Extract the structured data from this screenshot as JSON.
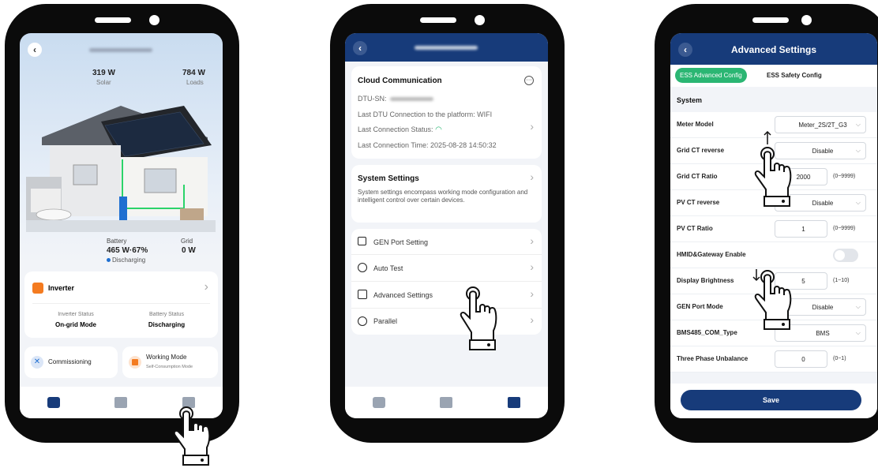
{
  "screen1": {
    "solar": {
      "value": "319 W",
      "label": "Solar"
    },
    "loads": {
      "value": "784 W",
      "label": "Loads"
    },
    "battery": {
      "label": "Battery",
      "value": "465 W·67%",
      "status": "Discharging"
    },
    "grid": {
      "label": "Grid",
      "value": "0 W"
    },
    "inverter": {
      "title": "Inverter",
      "inverter_status_label": "Inverter Status",
      "inverter_status": "On-grid Mode",
      "battery_status_label": "Battery Status",
      "battery_status": "Discharging"
    },
    "commissioning": "Commissioning",
    "working_mode": {
      "title": "Working Mode",
      "value": "Self-Consumption Mode"
    }
  },
  "screen2": {
    "cloud": {
      "title": "Cloud Communication",
      "dtu_sn": "DTU-SN:",
      "last_connection": "Last DTU Connection to the platform: WIFI",
      "last_status": "Last Connection Status:",
      "last_time": "Last Connection Time: 2025-08-28 14:50:32"
    },
    "system": {
      "title": "System Settings",
      "desc": "System settings encompass working mode configuration and intelligent control over certain devices."
    },
    "menu": [
      "GEN Port Setting",
      "Auto Test",
      "Advanced Settings",
      "Parallel"
    ]
  },
  "screen3": {
    "title": "Advanced Settings",
    "tabs": [
      "ESS Advanced Config",
      "ESS Safety Config"
    ],
    "section": "System",
    "rows": [
      {
        "label": "Meter Model",
        "value": "Meter_2S/2T_G3",
        "range": ""
      },
      {
        "label": "Grid CT reverse",
        "value": "Disable",
        "range": ""
      },
      {
        "label": "Grid CT Ratio",
        "value": "2000",
        "range": "(0~9999)"
      },
      {
        "label": "PV CT reverse",
        "value": "Disable",
        "range": ""
      },
      {
        "label": "PV CT Ratio",
        "value": "1",
        "range": "(0~9999)"
      },
      {
        "label": "HMID&Gateway Enable",
        "value": "",
        "range": ""
      },
      {
        "label": "Display Brightness",
        "value": "5",
        "range": "(1~10)"
      },
      {
        "label": "GEN Port Mode",
        "value": "Disable",
        "range": ""
      },
      {
        "label": "BMS485_COM_Type",
        "value": "BMS",
        "range": ""
      },
      {
        "label": "Three Phase Unbalance",
        "value": "0",
        "range": "(0~1)"
      }
    ],
    "save": "Save"
  },
  "colors": {
    "navy": "#173b7a",
    "green": "#2bb673",
    "orange": "#f47b20"
  }
}
